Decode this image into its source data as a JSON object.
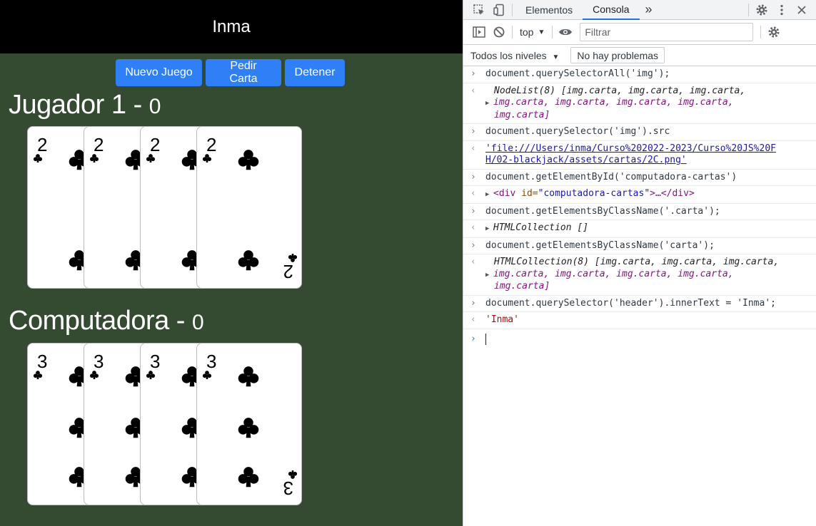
{
  "page": {
    "header_title": "Inma",
    "buttons": {
      "new_game": "Nuevo Juego",
      "ask_card": "Pedir Carta",
      "stop": "Detener"
    },
    "player": {
      "title": "Jugador 1 - ",
      "score": "0",
      "cards": [
        "2C",
        "2C",
        "2C",
        "2C"
      ]
    },
    "computer": {
      "title": "Computadora - ",
      "score": "0",
      "cards": [
        "3C",
        "3C",
        "3C",
        "3C"
      ]
    },
    "colors": {
      "background": "#344b32",
      "header": "#000000",
      "button": "#2f7ff7"
    }
  },
  "devtools": {
    "tabs": {
      "elements": "Elementos",
      "console": "Consola",
      "more": "»"
    },
    "toolbar": {
      "context": "top",
      "filter_placeholder": "Filtrar"
    },
    "levels": {
      "label": "Todos los niveles",
      "issues": "No hay problemas"
    },
    "console": [
      {
        "input": "document.querySelectorAll('img');"
      },
      {
        "output_type": "nodelist",
        "l1": "NodeList(8) [img.carta, img.carta, img.carta,",
        "l2": "img.carta, img.carta, img.carta, img.carta,",
        "l3": "img.carta]"
      },
      {
        "input": "document.querySelector('img').src"
      },
      {
        "output_type": "string",
        "l1": "'file:///Users/inma/Curso%202022-2023/Curso%20JS%20F",
        "l2": "H/02-blackjack/assets/cartas/2C.png'"
      },
      {
        "input": "document.getElementById('computadora-cartas')"
      },
      {
        "output_type": "element",
        "tag_open": "<div",
        "attr_name": " id=",
        "attr_value": "\"computadora-cartas\"",
        "tag_close": ">…</div>"
      },
      {
        "input": "document.getElementsByClassName('.carta');"
      },
      {
        "output_type": "collection",
        "l1": "HTMLCollection []"
      },
      {
        "input": "document.getElementsByClassName('carta');"
      },
      {
        "output_type": "collection8",
        "l1": "HTMLCollection(8) [img.carta, img.carta, img.carta,",
        "l2": "img.carta, img.carta, img.carta, img.carta,",
        "l3": "img.carta]"
      },
      {
        "input": "document.querySelector('header').innerText = 'Inma';"
      },
      {
        "output_type": "string",
        "l1": "'Inma'"
      }
    ]
  }
}
